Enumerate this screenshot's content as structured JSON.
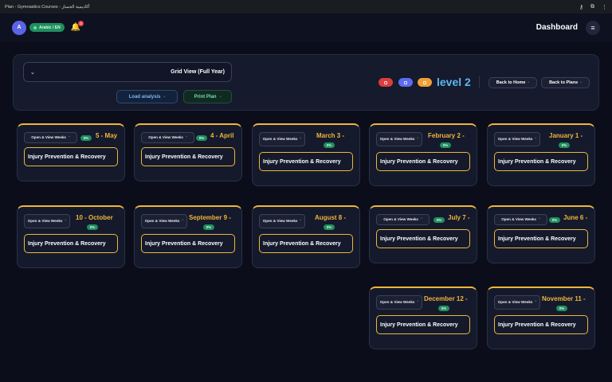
{
  "window": {
    "title": "Plan - Gymnastics Courses - أكاديمية الجمباز"
  },
  "header": {
    "avatar": "A",
    "language": "Arabic / EN",
    "notifications": "0",
    "title": "Dashboard"
  },
  "controls": {
    "view_select": "Grid View (Full Year)",
    "load_analysis": "Load analysis",
    "print_plan": "Print Plan",
    "level": "level 2",
    "back_home": "Back to Home",
    "back_plans": "Back to Plans"
  },
  "cards": [
    {
      "month": "5 - May",
      "open": "Open & View Weeks",
      "progress": "0%",
      "focus": "Injury Prevention & Recovery"
    },
    {
      "month": "4 - April",
      "open": "Open & View Weeks",
      "progress": "0%",
      "focus": "Injury Prevention & Recovery"
    },
    {
      "month": "March 3 -",
      "open": "Open & View Weeks",
      "progress": "0%",
      "focus": "Injury Prevention & Recovery"
    },
    {
      "month": "February 2 -",
      "open": "Open & View Weeks",
      "progress": "0%",
      "focus": "Injury Prevention & Recovery"
    },
    {
      "month": "January 1 -",
      "open": "Open & View Weeks",
      "progress": "0%",
      "focus": "Injury Prevention & Recovery"
    },
    {
      "month": "10 - October",
      "open": "Open & View Weeks",
      "progress": "0%",
      "focus": "Injury Prevention & Recovery"
    },
    {
      "month": "September 9 -",
      "open": "Open & View Weeks",
      "progress": "0%",
      "focus": "Injury Prevention & Recovery"
    },
    {
      "month": "August 8 -",
      "open": "Open & View Weeks",
      "progress": "0%",
      "focus": "Injury Prevention & Recovery"
    },
    {
      "month": "July 7 -",
      "open": "Open & View Weeks",
      "progress": "0%",
      "focus": "Injury Prevention & Recovery"
    },
    {
      "month": "June 6 -",
      "open": "Open & View Weeks",
      "progress": "0%",
      "focus": "Injury Prevention & Recovery"
    },
    {
      "month": "December 12 -",
      "open": "Open & View Weeks",
      "progress": "0%",
      "focus": "Injury Prevention & Recovery"
    },
    {
      "month": "November 11 -",
      "open": "Open & View Weeks",
      "progress": "0%",
      "focus": "Injury Prevention & Recovery"
    }
  ],
  "colors": {
    "accent_gold": "#f0b53a",
    "level_blue": "#5fb6f2",
    "progress_green": "#1f8f5e",
    "background": "#0b0e1a"
  }
}
